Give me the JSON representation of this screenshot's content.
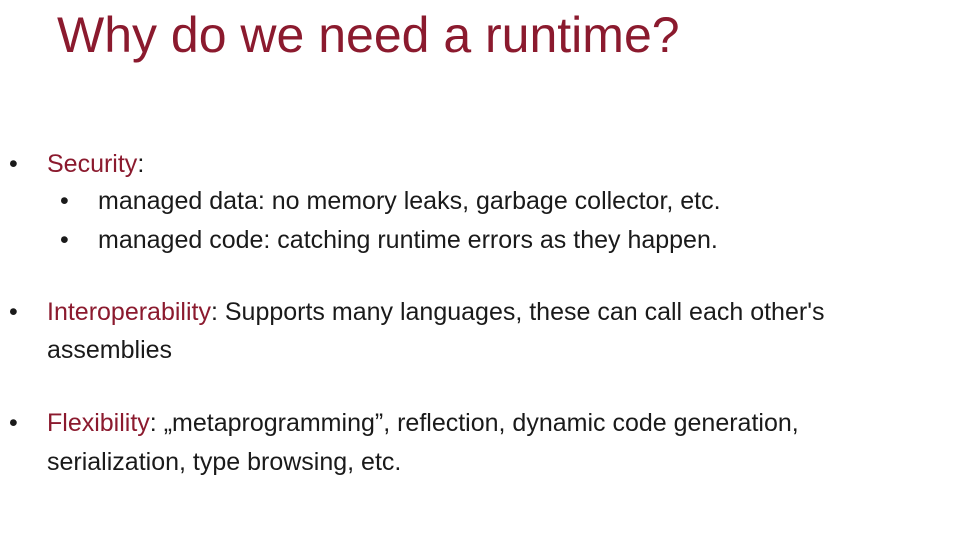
{
  "slide": {
    "title": "Why do we need a runtime?",
    "bullet_glyph": "•",
    "accent_color": "#8b1a2e",
    "items": [
      {
        "term": "Security",
        "text": ":",
        "subitems": [
          "managed data: no memory leaks, garbage collector, etc.",
          "managed code: catching runtime errors as they happen."
        ]
      },
      {
        "term": "Interoperability",
        "text": ": Supports many languages, these can call each other's",
        "continuation": "assemblies"
      },
      {
        "term": "Flexibility",
        "text": ": „metaprogramming”, reflection, dynamic code generation,",
        "continuation": "serialization, type browsing, etc."
      }
    ]
  }
}
